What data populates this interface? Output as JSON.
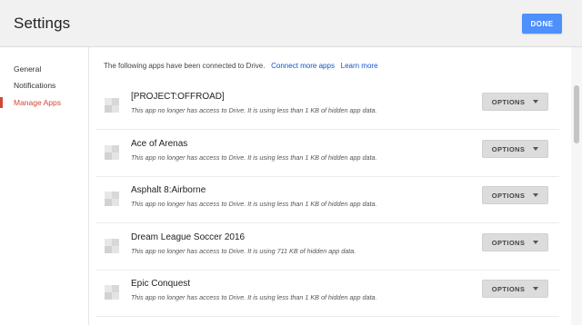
{
  "header": {
    "title": "Settings",
    "done_label": "DONE"
  },
  "sidebar": {
    "items": [
      {
        "label": "General",
        "active": false
      },
      {
        "label": "Notifications",
        "active": false
      },
      {
        "label": "Manage Apps",
        "active": true
      }
    ]
  },
  "main": {
    "intro": "The following apps have been connected to Drive.",
    "connect_more": "Connect more apps",
    "learn_more": "Learn more",
    "options_label": "OPTIONS",
    "apps": [
      {
        "name": "[PROJECT:OFFROAD]",
        "description": "This app no longer has access to Drive. It is using less than 1 KB of hidden app data."
      },
      {
        "name": "Ace of Arenas",
        "description": "This app no longer has access to Drive. It is using less than 1 KB of hidden app data."
      },
      {
        "name": "Asphalt 8:Airborne",
        "description": "This app no longer has access to Drive. It is using less than 1 KB of hidden app data."
      },
      {
        "name": "Dream League Soccer 2016",
        "description": "This app no longer has access to Drive. It is using 711 KB of hidden app data."
      },
      {
        "name": "Epic Conquest",
        "description": "This app no longer has access to Drive. It is using less than 1 KB of hidden app data."
      }
    ]
  },
  "colors": {
    "accent_blue": "#4d90fe",
    "active_red": "#d14836",
    "link_blue": "#1155cc"
  }
}
